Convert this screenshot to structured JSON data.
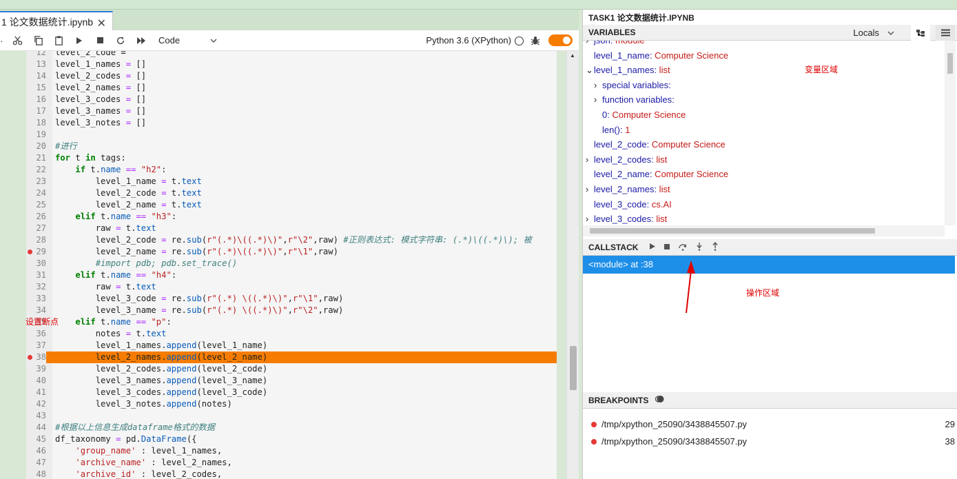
{
  "tab": {
    "title": "1 论文数据统计.ipynb",
    "close": "✕"
  },
  "toolbar": {
    "cell_type": "Code",
    "kernel": "Python 3.6 (XPython)"
  },
  "editor": {
    "lines": [
      {
        "num": "12",
        "html": "level_2_code ="
      },
      {
        "num": "13",
        "html": "level_1_names <span class='op'>=</span> []"
      },
      {
        "num": "14",
        "html": "level_2_codes <span class='op'>=</span> []"
      },
      {
        "num": "15",
        "html": "level_2_names <span class='op'>=</span> []"
      },
      {
        "num": "16",
        "html": "level_3_codes <span class='op'>=</span> []"
      },
      {
        "num": "17",
        "html": "level_3_names <span class='op'>=</span> []"
      },
      {
        "num": "18",
        "html": "level_3_notes <span class='op'>=</span> []"
      },
      {
        "num": "19",
        "html": ""
      },
      {
        "num": "20",
        "html": "<span class='cm'>#进行</span>"
      },
      {
        "num": "21",
        "html": "<span class='kw'>for</span> t <span class='kw'>in</span> tags:"
      },
      {
        "num": "22",
        "html": "    <span class='kw'>if</span> t.<span class='attr'>name</span> <span class='op'>==</span> <span class='str'>\"h2\"</span>:"
      },
      {
        "num": "23",
        "html": "        level_1_name <span class='op'>=</span> t.<span class='attr'>text</span>"
      },
      {
        "num": "24",
        "html": "        level_2_code <span class='op'>=</span> t.<span class='attr'>text</span>"
      },
      {
        "num": "25",
        "html": "        level_2_name <span class='op'>=</span> t.<span class='attr'>text</span>"
      },
      {
        "num": "26",
        "html": "    <span class='kw'>elif</span> t.<span class='attr'>name</span> <span class='op'>==</span> <span class='str'>\"h3\"</span>:"
      },
      {
        "num": "27",
        "html": "        raw <span class='op'>=</span> t.<span class='attr'>text</span>"
      },
      {
        "num": "28",
        "html": "        level_2_code <span class='op'>=</span> re.<span class='attr'>sub</span>(<span class='str'>r\"(.*)\\((.*)\\)\"</span>,<span class='str'>r\"\\2\"</span>,raw) <span class='cm'>#正则表达式: 模式字符串: (.*)\\((.*)\\); 被</span>"
      },
      {
        "num": "29",
        "html": "        level_2_name <span class='op'>=</span> re.<span class='attr'>sub</span>(<span class='str'>r\"(.*)\\((.*)\\)\"</span>,<span class='str'>r\"\\1\"</span>,raw)",
        "bp": true
      },
      {
        "num": "30",
        "html": "        <span class='cm'>#import pdb; pdb.set_trace()</span>"
      },
      {
        "num": "31",
        "html": "    <span class='kw'>elif</span> t.<span class='attr'>name</span> <span class='op'>==</span> <span class='str'>\"h4\"</span>:"
      },
      {
        "num": "32",
        "html": "        raw <span class='op'>=</span> t.<span class='attr'>text</span>"
      },
      {
        "num": "33",
        "html": "        level_3_code <span class='op'>=</span> re.<span class='attr'>sub</span>(<span class='str'>r\"(.*) \\((.*)\\)\"</span>,<span class='str'>r\"\\1\"</span>,raw)"
      },
      {
        "num": "34",
        "html": "        level_3_name <span class='op'>=</span> re.<span class='attr'>sub</span>(<span class='str'>r\"(.*) \\((.*)\\)\"</span>,<span class='str'>r\"\\2\"</span>,raw)"
      },
      {
        "num": "35",
        "html": "    <span class='kw'>elif</span> t.<span class='attr'>name</span> <span class='op'>==</span> <span class='str'>\"p\"</span>:"
      },
      {
        "num": "36",
        "html": "        notes <span class='op'>=</span> t.<span class='attr'>text</span>"
      },
      {
        "num": "37",
        "html": "        level_1_names.<span class='attr'>append</span>(level_1_name)"
      },
      {
        "num": "38",
        "html": "        level_2_names.<span class='attr'>append</span>(level_2_name)",
        "bp": true,
        "hl": true
      },
      {
        "num": "39",
        "html": "        level_2_codes.<span class='attr'>append</span>(level_2_code)"
      },
      {
        "num": "40",
        "html": "        level_3_names.<span class='attr'>append</span>(level_3_name)"
      },
      {
        "num": "41",
        "html": "        level_3_codes.<span class='attr'>append</span>(level_3_code)"
      },
      {
        "num": "42",
        "html": "        level_3_notes.<span class='attr'>append</span>(notes)"
      },
      {
        "num": "43",
        "html": ""
      },
      {
        "num": "44",
        "html": "<span class='cm'>#根据以上信息生成dataframe格式的数据</span>"
      },
      {
        "num": "45",
        "html": "df_taxonomy <span class='op'>=</span> pd.<span class='attr'>DataFrame</span>({"
      },
      {
        "num": "46",
        "html": "    <span class='str'>'group_name'</span> : level_1_names,"
      },
      {
        "num": "47",
        "html": "    <span class='str'>'archive_name'</span> : level_2_names,"
      },
      {
        "num": "48",
        "html": "    <span class='str'>'archive_id'</span> : level_2_codes,"
      }
    ],
    "breakpoint_label": "设置断点"
  },
  "debugger": {
    "file_title": "TASK1 论文数据统计.IPYNB",
    "variables_title": "VARIABLES",
    "scope": "Locals",
    "variables": [
      {
        "chev": "›",
        "name": "json",
        "value": "module",
        "indent": 0
      },
      {
        "chev": "",
        "name": "level_1_name",
        "value": "Computer Science",
        "indent": 0
      },
      {
        "chev": "⌄",
        "name": "level_1_names",
        "value": "list",
        "indent": 0
      },
      {
        "chev": "›",
        "name": "special variables",
        "value": "",
        "indent": 1
      },
      {
        "chev": "›",
        "name": "function variables",
        "value": "",
        "indent": 1
      },
      {
        "chev": "",
        "name": "0",
        "value": "Computer Science",
        "indent": 1
      },
      {
        "chev": "",
        "name": "len()",
        "value": "1",
        "indent": 1
      },
      {
        "chev": "",
        "name": "level_2_code",
        "value": "Computer Science",
        "indent": 0
      },
      {
        "chev": "›",
        "name": "level_2_codes",
        "value": "list",
        "indent": 0
      },
      {
        "chev": "",
        "name": "level_2_name",
        "value": "Computer Science",
        "indent": 0
      },
      {
        "chev": "›",
        "name": "level_2_names",
        "value": "list",
        "indent": 0
      },
      {
        "chev": "",
        "name": "level_3_code",
        "value": "cs.AI",
        "indent": 0
      },
      {
        "chev": "›",
        "name": "level_3_codes",
        "value": "list",
        "indent": 0
      }
    ],
    "variables_annotation": "变量区域",
    "callstack_title": "CALLSTACK",
    "callstack_frame": "<module> at :38",
    "operations_annotation": "操作区域",
    "breakpoints_title": "BREAKPOINTS",
    "breakpoints": [
      {
        "path": "/tmp/xpython_25090/3438845507.py",
        "line": "29"
      },
      {
        "path": "/tmp/xpython_25090/3438845507.py",
        "line": "38"
      }
    ]
  },
  "colors": {
    "accent": "#f57c00",
    "selection": "#1e8fe8",
    "breakpoint": "#e53935",
    "annotation": "#e00000"
  }
}
